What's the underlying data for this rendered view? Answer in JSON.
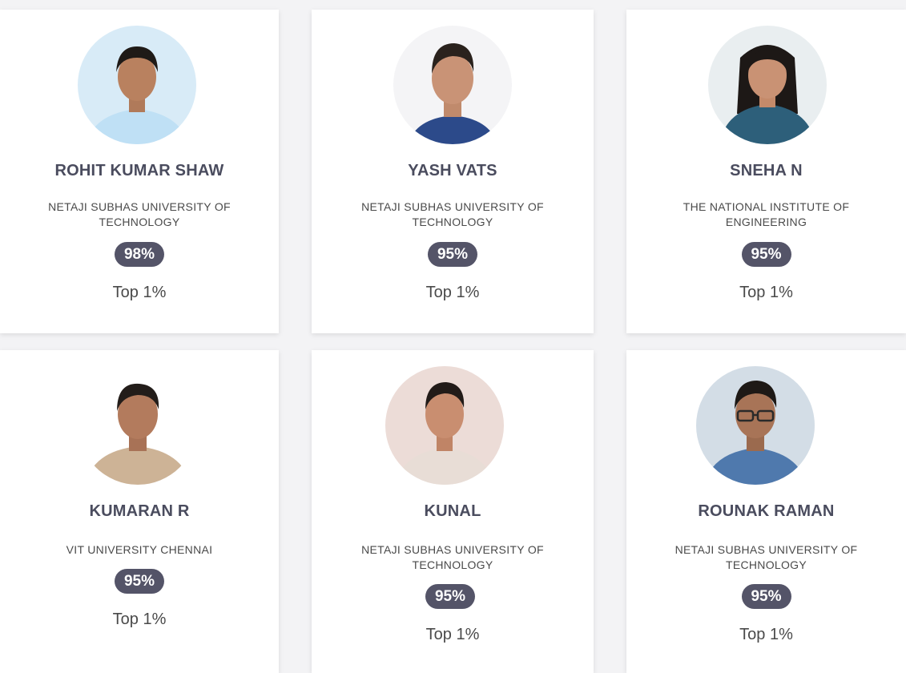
{
  "students": [
    {
      "name": "ROHIT KUMAR SHAW",
      "university": "NETAJI SUBHAS UNIVERSITY OF TECHNOLOGY",
      "score": "98%",
      "rank": "Top 1%",
      "photo_icon": "student-photo-1"
    },
    {
      "name": "YASH VATS",
      "university": "NETAJI SUBHAS UNIVERSITY OF TECHNOLOGY",
      "score": "95%",
      "rank": "Top 1%",
      "photo_icon": "student-photo-2"
    },
    {
      "name": "SNEHA N",
      "university": "THE NATIONAL INSTITUTE OF ENGINEERING",
      "score": "95%",
      "rank": "Top 1%",
      "photo_icon": "student-photo-3"
    },
    {
      "name": "KUMARAN R",
      "university": "VIT UNIVERSITY CHENNAI",
      "score": "95%",
      "rank": "Top 1%",
      "photo_icon": "student-photo-4"
    },
    {
      "name": "KUNAL",
      "university": "NETAJI SUBHAS UNIVERSITY OF TECHNOLOGY",
      "score": "95%",
      "rank": "Top 1%",
      "photo_icon": "student-photo-5"
    },
    {
      "name": "ROUNAK RAMAN",
      "university": "NETAJI SUBHAS UNIVERSITY OF TECHNOLOGY",
      "score": "95%",
      "rank": "Top 1%",
      "photo_icon": "student-photo-6"
    }
  ],
  "colors": {
    "badge_bg": "#545468",
    "name_text": "#4a4c5e",
    "card_bg": "#ffffff",
    "page_bg": "#f3f3f5"
  }
}
